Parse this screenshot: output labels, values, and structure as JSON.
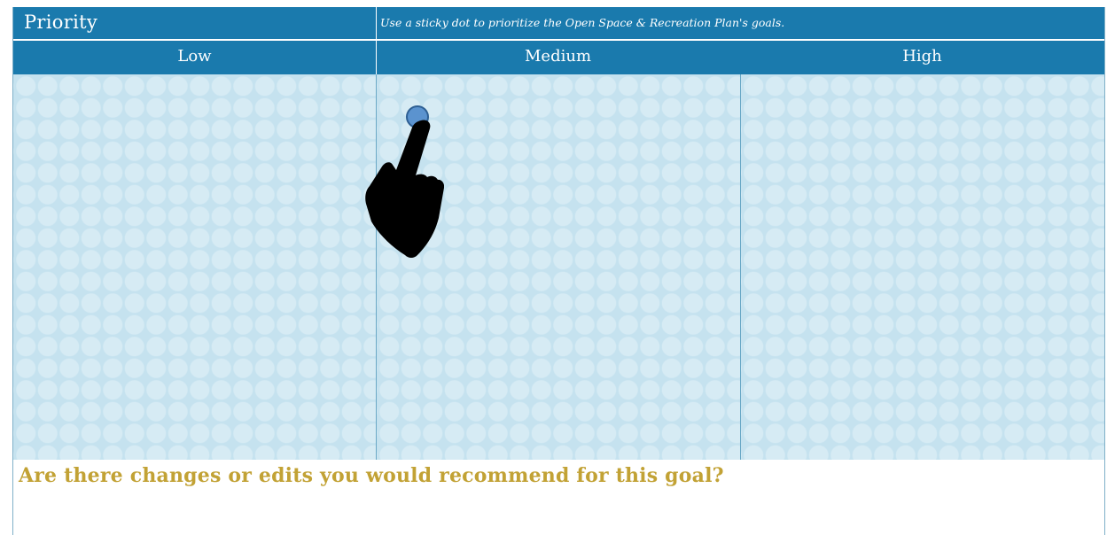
{
  "header": {
    "title": "Priority",
    "instruction": "Use a sticky dot to prioritize the Open Space & Recreation Plan's goals."
  },
  "columns": [
    {
      "label": "Low"
    },
    {
      "label": "Medium"
    },
    {
      "label": "High"
    }
  ],
  "question": {
    "text": "Are there changes or edits you would recommend for this goal?"
  },
  "colors": {
    "header_blue": "#1a7aad",
    "dot_area": "#c5e2ef",
    "sticky_dot": "#5b93cf",
    "question_gold": "#c2a235"
  },
  "icons": {
    "hand": "pointing-hand-icon",
    "dot": "sticky-dot-icon"
  }
}
